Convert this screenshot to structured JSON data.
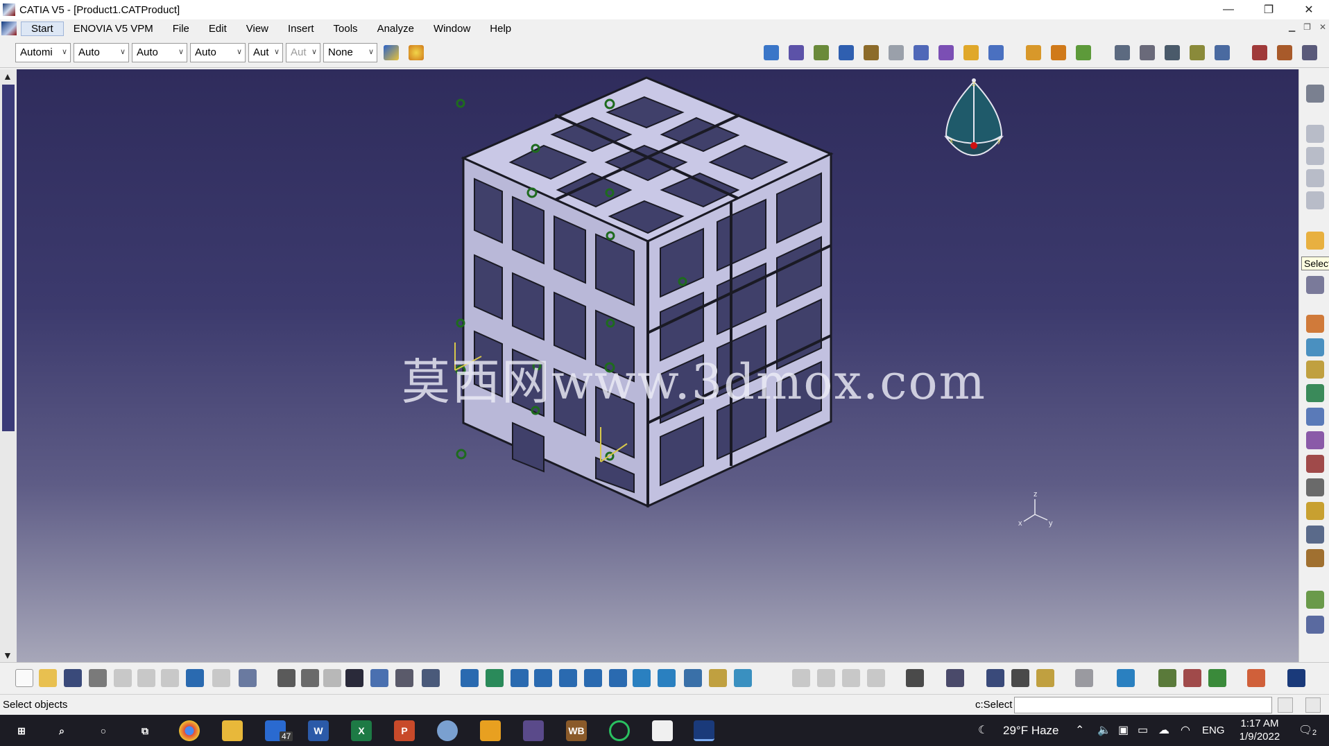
{
  "window": {
    "title": "CATIA V5 - [Product1.CATProduct]",
    "minimize": "—",
    "restore": "❐",
    "close": "✕"
  },
  "menu": {
    "items": [
      "Start",
      "ENOVIA V5 VPM",
      "File",
      "Edit",
      "View",
      "Insert",
      "Tools",
      "Analyze",
      "Window",
      "Help"
    ]
  },
  "toolbar_top": {
    "combos": [
      "Automi",
      "Auto",
      "Auto",
      "Auto",
      "Aut",
      "Aut",
      "None"
    ]
  },
  "viewport": {
    "watermark": "莫西网www.3dmox.com",
    "compass_axes": [
      "z",
      "x",
      "y"
    ],
    "triad_axes": [
      "z",
      "x",
      "y"
    ]
  },
  "right_toolbar": {
    "tooltip": "Select"
  },
  "statusbar": {
    "message": "Select objects",
    "command_label": "c:Select",
    "command_value": ""
  },
  "taskbar": {
    "mail_badge": "47",
    "weather": "29°F  Haze",
    "language": "ENG",
    "time": "1:17 AM",
    "date": "1/9/2022",
    "notifications": "2"
  },
  "colors": {
    "viewport_top": "#2f2c5c",
    "viewport_bottom": "#a7a7b9",
    "part_face": "#c9c8e6",
    "part_edge": "#1a1a24",
    "constraint_green": "#1e6b1e"
  }
}
